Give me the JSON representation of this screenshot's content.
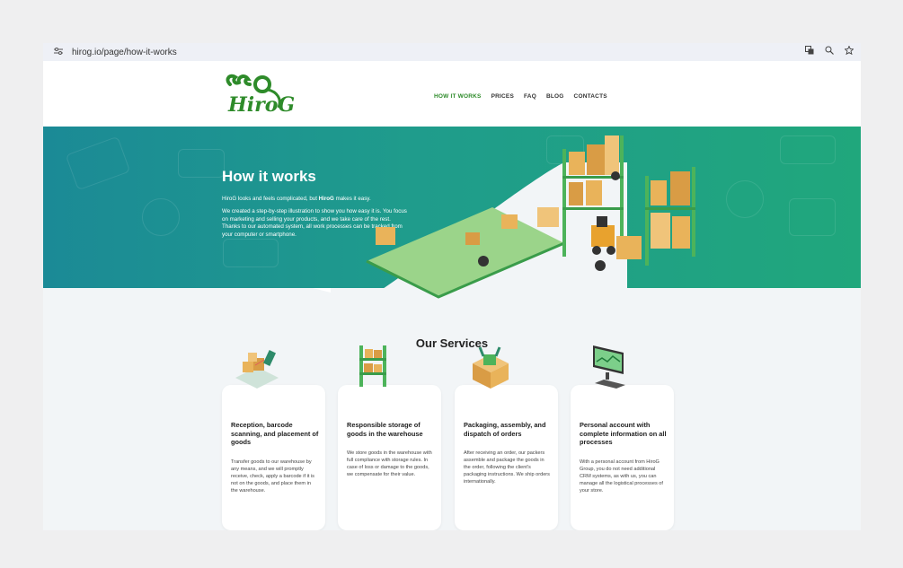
{
  "browser": {
    "url": "hirog.io/page/how-it-works",
    "icons": [
      "tune-icon",
      "translate-icon",
      "zoom-icon",
      "star-icon"
    ]
  },
  "header": {
    "logo_text": "HiroG",
    "nav": [
      {
        "label": "HOW IT WORKS",
        "active": true
      },
      {
        "label": "PRICES",
        "active": false
      },
      {
        "label": "FAQ",
        "active": false
      },
      {
        "label": "BLOG",
        "active": false
      },
      {
        "label": "CONTACTS",
        "active": false
      }
    ]
  },
  "hero": {
    "title": "How it works",
    "intro_before": "HiroG looks and feels complicated, but ",
    "intro_bold": "HiroG",
    "intro_after": " makes it easy.",
    "body": "We created a step-by-step illustration to show you how easy it is. You focus on marketing and selling your products, and we take care of the rest. Thanks to our automated system, all work processes can be tracked from your computer or smartphone."
  },
  "services": {
    "title": "Our Services",
    "cards": [
      {
        "title": "Reception, barcode scanning, and placement of goods",
        "text": "Transfer goods to our warehouse by any means, and we will promptly receive, check, apply a barcode if it is not on the goods, and place them in the warehouse.",
        "icon": "barcode-scanner-icon"
      },
      {
        "title": "Responsible storage of goods in the warehouse",
        "text": "We store goods in the warehouse with full compliance with storage rules. In case of loss or damage to the goods, we compensate for their value.",
        "icon": "warehouse-rack-icon"
      },
      {
        "title": "Packaging, assembly, and dispatch of orders",
        "text": "After receiving an order, our packers assemble and package the goods in the order, following the client's packaging instructions. We ship orders internationally.",
        "icon": "package-icon"
      },
      {
        "title": "Personal account with complete information on all processes",
        "text": "With a personal account from HiroG Group, you do not need additional CRM systems, as with us, you can manage all the logistical processes of your store.",
        "icon": "computer-monitor-icon"
      }
    ]
  },
  "colors": {
    "brand_green": "#2e8b2a",
    "hero_teal_start": "#1b8a96",
    "hero_teal_end": "#20a77c",
    "box": "#e9b35a"
  }
}
